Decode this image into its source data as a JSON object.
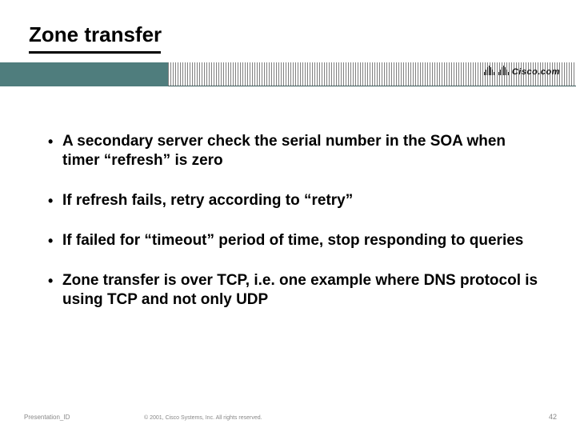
{
  "title": "Zone transfer",
  "logo_text": "Cisco.com",
  "bullets": [
    "A secondary server check the serial number in the SOA when timer “refresh” is zero",
    "If refresh fails, retry according to “retry”",
    "If failed for “timeout” period of time, stop responding to queries",
    "Zone transfer is over TCP, i.e. one example where DNS protocol is using TCP and not only UDP"
  ],
  "footer": {
    "left": "Presentation_ID",
    "center": "© 2001, Cisco Systems, Inc. All rights reserved.",
    "page": "42"
  }
}
